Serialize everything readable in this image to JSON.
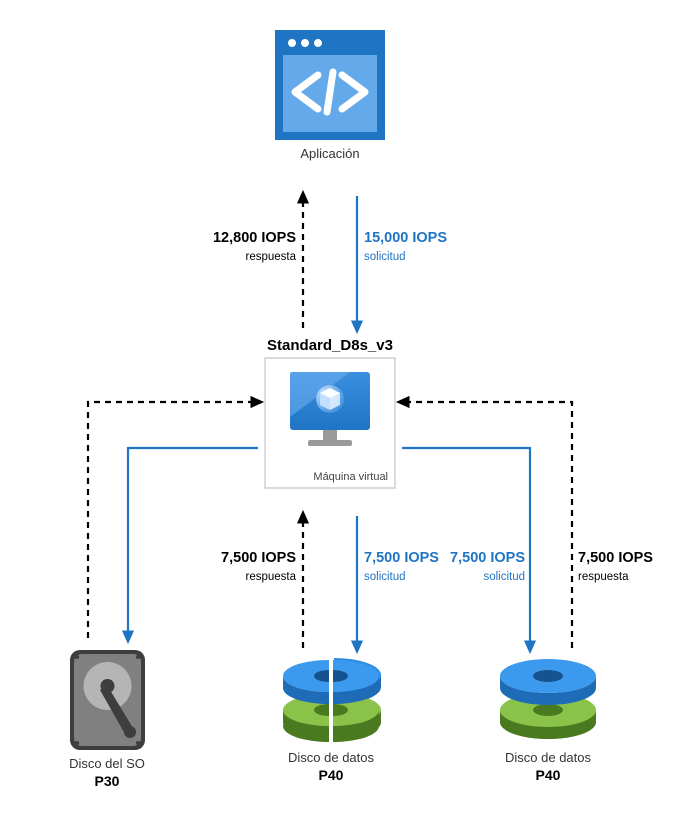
{
  "colors": {
    "blue_primary": "#1f74c3",
    "blue_mid": "#3b8fe0",
    "blue_light": "#64a9ea",
    "blue_disk": "#2d8ee6",
    "green_disk": "#6aaa2c",
    "gray_dark": "#3e3e3e",
    "gray_light": "#9a9a9a",
    "gray_border": "#cfcfcf"
  },
  "app": {
    "label": "Aplicación"
  },
  "vm": {
    "title": "Standard_D8s_v3",
    "sublabel": "Máquina virtual"
  },
  "flows": {
    "app_to_vm": {
      "request_value": "15,000 IOPS",
      "request_sub": "solicitud",
      "response_value": "12,800 IOPS",
      "response_sub": "respuesta"
    },
    "vm_to_disk1": {
      "request_value": "7,500 IOPS",
      "request_sub": "solicitud",
      "response_value": "7,500 IOPS",
      "response_sub": "respuesta"
    },
    "vm_to_disk2": {
      "request_value": "7,500 IOPS",
      "request_sub": "solicitud",
      "response_value": "7,500 IOPS",
      "response_sub": "respuesta"
    }
  },
  "os_disk": {
    "label": "Disco del SO",
    "model": "P30"
  },
  "data_disk_1": {
    "label": "Disco de datos",
    "model": "P40"
  },
  "data_disk_2": {
    "label": "Disco de datos",
    "model": "P40"
  },
  "chart_data": {
    "type": "diagram",
    "nodes": [
      {
        "id": "app",
        "label": "Aplicación",
        "kind": "application"
      },
      {
        "id": "vm",
        "label": "Standard_D8s_v3",
        "sublabel": "Máquina virtual",
        "kind": "virtual_machine"
      },
      {
        "id": "os_disk",
        "label": "Disco del SO",
        "model": "P30",
        "kind": "os_disk"
      },
      {
        "id": "data_disk_1",
        "label": "Disco de datos",
        "model": "P40",
        "kind": "data_disk"
      },
      {
        "id": "data_disk_2",
        "label": "Disco de datos",
        "model": "P40",
        "kind": "data_disk"
      }
    ],
    "edges": [
      {
        "from": "app",
        "to": "vm",
        "direction": "request",
        "value": 15000,
        "unit": "IOPS",
        "label": "solicitud"
      },
      {
        "from": "vm",
        "to": "app",
        "direction": "response",
        "value": 12800,
        "unit": "IOPS",
        "label": "respuesta"
      },
      {
        "from": "vm",
        "to": "os_disk",
        "direction": "connection",
        "value": null,
        "unit": null,
        "label": null
      },
      {
        "from": "vm",
        "to": "data_disk_1",
        "direction": "request",
        "value": 7500,
        "unit": "IOPS",
        "label": "solicitud"
      },
      {
        "from": "data_disk_1",
        "to": "vm",
        "direction": "response",
        "value": 7500,
        "unit": "IOPS",
        "label": "respuesta"
      },
      {
        "from": "vm",
        "to": "data_disk_2",
        "direction": "request",
        "value": 7500,
        "unit": "IOPS",
        "label": "solicitud"
      },
      {
        "from": "data_disk_2",
        "to": "vm",
        "direction": "response",
        "value": 7500,
        "unit": "IOPS",
        "label": "respuesta"
      }
    ]
  }
}
